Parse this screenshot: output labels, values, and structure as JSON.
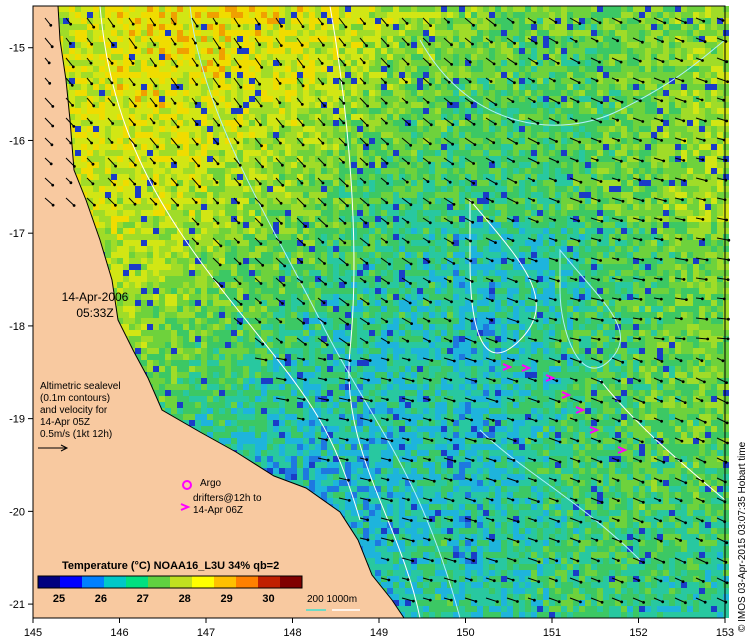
{
  "map": {
    "lon_min": 145,
    "lon_max": 153,
    "lat_min": -21.15,
    "lat_max": -14.55,
    "lon_ticks": [
      "145",
      "146",
      "147",
      "148",
      "149",
      "150",
      "151",
      "152",
      "153"
    ],
    "lat_ticks": [
      "-15",
      "-16",
      "-17",
      "-18",
      "-19",
      "-20",
      "-21"
    ],
    "land_color": "#f8c9a0",
    "ocean_base_color": "#44c45a"
  },
  "datetime": {
    "date": "14-Apr-2006",
    "time": "05:33Z"
  },
  "sealevel_note": {
    "lines": [
      "Altimetric sealevel",
      "(0.1m contours)",
      "and velocity for",
      "14-Apr 05Z",
      "0.5m/s (1kt 12h)"
    ]
  },
  "legend": {
    "argo_label": "Argo",
    "drifters_line1": "drifters@12h to",
    "drifters_line2": "14-Apr 06Z",
    "marker_color": "#ff00ff"
  },
  "colorbar": {
    "title": "Temperature (°C) NOAA16_L3U 34% qb=2",
    "min": 24.5,
    "max": 30.8,
    "ticks": [
      "25",
      "26",
      "27",
      "28",
      "29",
      "30"
    ],
    "colors": [
      "#00007f",
      "#0000ff",
      "#0080ff",
      "#00c8c8",
      "#00e080",
      "#60d040",
      "#c0e020",
      "#ffff00",
      "#ffc000",
      "#ff8000",
      "#c02000",
      "#800000"
    ]
  },
  "depth_legend": {
    "label": "200  1000m",
    "color": "#40e0d0"
  },
  "credit": "© IMOS 03-Apr-2015 03:07:35 Hobart time"
}
